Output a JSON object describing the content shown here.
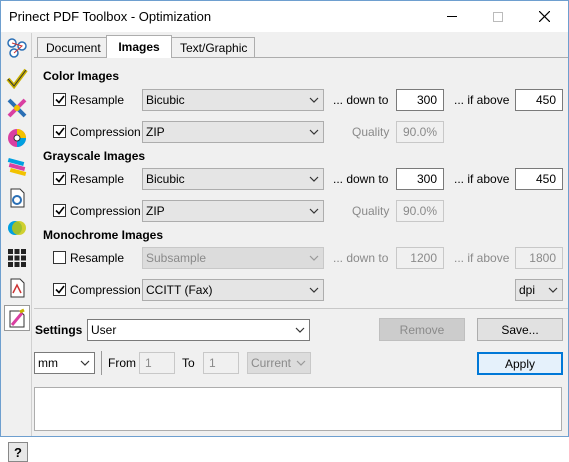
{
  "window": {
    "title": "Prinect PDF Toolbox - Optimization"
  },
  "tabs": [
    {
      "label": "Document",
      "active": false
    },
    {
      "label": "Images",
      "active": true
    },
    {
      "label": "Text/Graphic",
      "active": false
    }
  ],
  "color_images": {
    "heading": "Color Images",
    "resample": {
      "label": "Resample",
      "checked": true,
      "method": "Bicubic",
      "down_to_label": "... down to",
      "down_to": "300",
      "if_above_label": "... if above",
      "if_above": "450"
    },
    "compression": {
      "label": "Compression",
      "checked": true,
      "method": "ZIP",
      "quality_label": "Quality",
      "quality": "90.0%"
    }
  },
  "grayscale_images": {
    "heading": "Grayscale Images",
    "resample": {
      "label": "Resample",
      "checked": true,
      "method": "Bicubic",
      "down_to_label": "... down to",
      "down_to": "300",
      "if_above_label": "... if above",
      "if_above": "450"
    },
    "compression": {
      "label": "Compression",
      "checked": true,
      "method": "ZIP",
      "quality_label": "Quality",
      "quality": "90.0%"
    }
  },
  "monochrome_images": {
    "heading": "Monochrome Images",
    "resample": {
      "label": "Resample",
      "checked": false,
      "method": "Subsample",
      "down_to_label": "... down to",
      "down_to": "1200",
      "if_above_label": "... if above",
      "if_above": "1800"
    },
    "compression": {
      "label": "Compression",
      "checked": true,
      "method": "CCITT (Fax)",
      "unit": "dpi"
    }
  },
  "settings": {
    "label": "Settings",
    "value": "User",
    "remove_label": "Remove",
    "save_label": "Save..."
  },
  "page_range": {
    "unit": "mm",
    "from_label": "From",
    "from": "1",
    "to_label": "To",
    "to": "1",
    "scope": "Current"
  },
  "apply_label": "Apply",
  "help_label": "?",
  "colors": {
    "accent": "#0078d7",
    "window_border": "#6e9fcf"
  }
}
